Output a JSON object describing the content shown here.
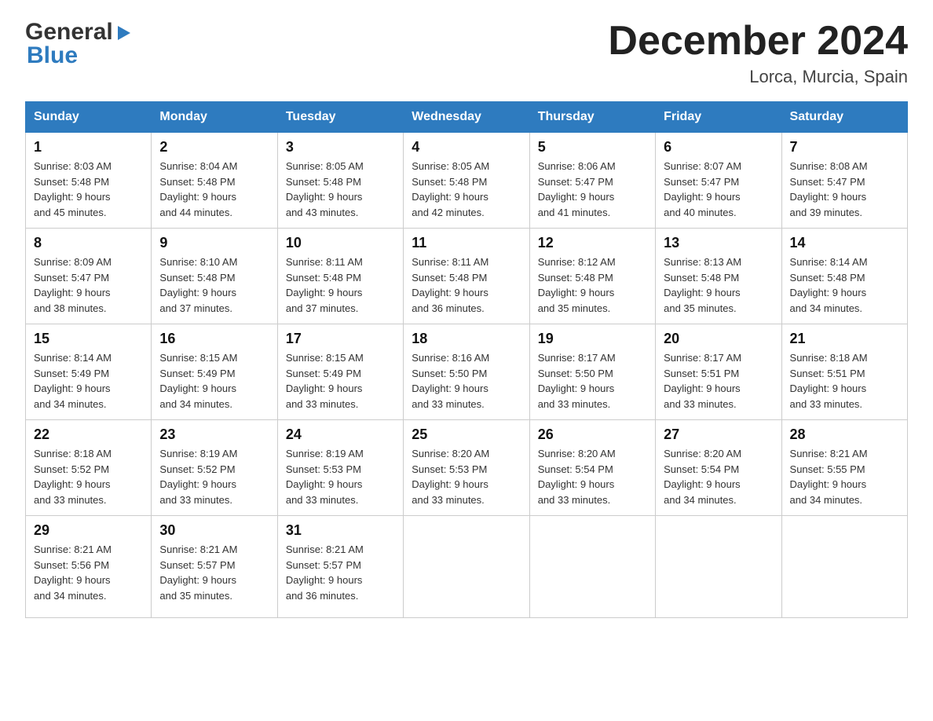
{
  "logo": {
    "line1": "General",
    "line2": "Blue",
    "arrow": "▶"
  },
  "title": "December 2024",
  "subtitle": "Lorca, Murcia, Spain",
  "days_of_week": [
    "Sunday",
    "Monday",
    "Tuesday",
    "Wednesday",
    "Thursday",
    "Friday",
    "Saturday"
  ],
  "weeks": [
    [
      {
        "day": "1",
        "sunrise": "8:03 AM",
        "sunset": "5:48 PM",
        "daylight": "9 hours and 45 minutes."
      },
      {
        "day": "2",
        "sunrise": "8:04 AM",
        "sunset": "5:48 PM",
        "daylight": "9 hours and 44 minutes."
      },
      {
        "day": "3",
        "sunrise": "8:05 AM",
        "sunset": "5:48 PM",
        "daylight": "9 hours and 43 minutes."
      },
      {
        "day": "4",
        "sunrise": "8:05 AM",
        "sunset": "5:48 PM",
        "daylight": "9 hours and 42 minutes."
      },
      {
        "day": "5",
        "sunrise": "8:06 AM",
        "sunset": "5:47 PM",
        "daylight": "9 hours and 41 minutes."
      },
      {
        "day": "6",
        "sunrise": "8:07 AM",
        "sunset": "5:47 PM",
        "daylight": "9 hours and 40 minutes."
      },
      {
        "day": "7",
        "sunrise": "8:08 AM",
        "sunset": "5:47 PM",
        "daylight": "9 hours and 39 minutes."
      }
    ],
    [
      {
        "day": "8",
        "sunrise": "8:09 AM",
        "sunset": "5:47 PM",
        "daylight": "9 hours and 38 minutes."
      },
      {
        "day": "9",
        "sunrise": "8:10 AM",
        "sunset": "5:48 PM",
        "daylight": "9 hours and 37 minutes."
      },
      {
        "day": "10",
        "sunrise": "8:11 AM",
        "sunset": "5:48 PM",
        "daylight": "9 hours and 37 minutes."
      },
      {
        "day": "11",
        "sunrise": "8:11 AM",
        "sunset": "5:48 PM",
        "daylight": "9 hours and 36 minutes."
      },
      {
        "day": "12",
        "sunrise": "8:12 AM",
        "sunset": "5:48 PM",
        "daylight": "9 hours and 35 minutes."
      },
      {
        "day": "13",
        "sunrise": "8:13 AM",
        "sunset": "5:48 PM",
        "daylight": "9 hours and 35 minutes."
      },
      {
        "day": "14",
        "sunrise": "8:14 AM",
        "sunset": "5:48 PM",
        "daylight": "9 hours and 34 minutes."
      }
    ],
    [
      {
        "day": "15",
        "sunrise": "8:14 AM",
        "sunset": "5:49 PM",
        "daylight": "9 hours and 34 minutes."
      },
      {
        "day": "16",
        "sunrise": "8:15 AM",
        "sunset": "5:49 PM",
        "daylight": "9 hours and 34 minutes."
      },
      {
        "day": "17",
        "sunrise": "8:15 AM",
        "sunset": "5:49 PM",
        "daylight": "9 hours and 33 minutes."
      },
      {
        "day": "18",
        "sunrise": "8:16 AM",
        "sunset": "5:50 PM",
        "daylight": "9 hours and 33 minutes."
      },
      {
        "day": "19",
        "sunrise": "8:17 AM",
        "sunset": "5:50 PM",
        "daylight": "9 hours and 33 minutes."
      },
      {
        "day": "20",
        "sunrise": "8:17 AM",
        "sunset": "5:51 PM",
        "daylight": "9 hours and 33 minutes."
      },
      {
        "day": "21",
        "sunrise": "8:18 AM",
        "sunset": "5:51 PM",
        "daylight": "9 hours and 33 minutes."
      }
    ],
    [
      {
        "day": "22",
        "sunrise": "8:18 AM",
        "sunset": "5:52 PM",
        "daylight": "9 hours and 33 minutes."
      },
      {
        "day": "23",
        "sunrise": "8:19 AM",
        "sunset": "5:52 PM",
        "daylight": "9 hours and 33 minutes."
      },
      {
        "day": "24",
        "sunrise": "8:19 AM",
        "sunset": "5:53 PM",
        "daylight": "9 hours and 33 minutes."
      },
      {
        "day": "25",
        "sunrise": "8:20 AM",
        "sunset": "5:53 PM",
        "daylight": "9 hours and 33 minutes."
      },
      {
        "day": "26",
        "sunrise": "8:20 AM",
        "sunset": "5:54 PM",
        "daylight": "9 hours and 33 minutes."
      },
      {
        "day": "27",
        "sunrise": "8:20 AM",
        "sunset": "5:54 PM",
        "daylight": "9 hours and 34 minutes."
      },
      {
        "day": "28",
        "sunrise": "8:21 AM",
        "sunset": "5:55 PM",
        "daylight": "9 hours and 34 minutes."
      }
    ],
    [
      {
        "day": "29",
        "sunrise": "8:21 AM",
        "sunset": "5:56 PM",
        "daylight": "9 hours and 34 minutes."
      },
      {
        "day": "30",
        "sunrise": "8:21 AM",
        "sunset": "5:57 PM",
        "daylight": "9 hours and 35 minutes."
      },
      {
        "day": "31",
        "sunrise": "8:21 AM",
        "sunset": "5:57 PM",
        "daylight": "9 hours and 36 minutes."
      },
      null,
      null,
      null,
      null
    ]
  ],
  "labels": {
    "sunrise": "Sunrise:",
    "sunset": "Sunset:",
    "daylight": "Daylight:"
  }
}
